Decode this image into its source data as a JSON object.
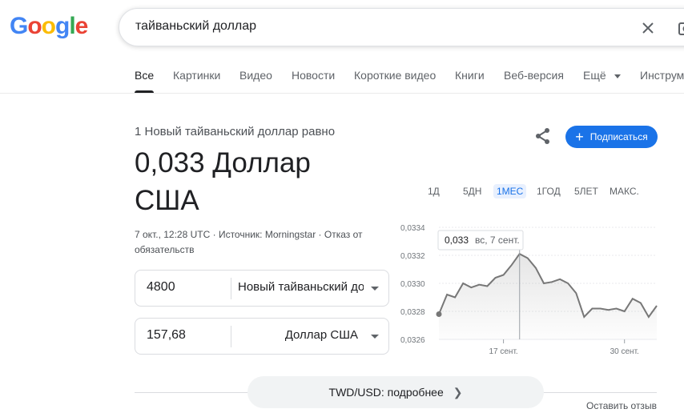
{
  "logo": {
    "letters": [
      "G",
      "o",
      "o",
      "g",
      "l",
      "e"
    ],
    "colors": [
      "#4285f4",
      "#ea4335",
      "#fbbc05",
      "#4285f4",
      "#34a853",
      "#ea4335"
    ]
  },
  "search": {
    "query": "тайваньский доллар"
  },
  "tabs": [
    "Все",
    "Картинки",
    "Видео",
    "Новости",
    "Короткие видео",
    "Книги",
    "Веб-версия",
    "Ещё",
    "Инструм"
  ],
  "converter": {
    "equals_text": "1 Новый тайваньский доллар равно",
    "result_text": "0,033 Доллар США",
    "timestamp": "7 окт., 12:28 UTC",
    "source": "Источник: Morningstar",
    "disclaimer": "Отказ от обязательств",
    "from_amount": "4800",
    "from_currency": "Новый тайваньский до",
    "to_amount": "157,68",
    "to_currency": "Доллар США"
  },
  "actions": {
    "subscribe": "Подписаться"
  },
  "ranges": [
    "1Д",
    "5ДН",
    "1МЕС",
    "1ГОД",
    "5ЛЕТ",
    "МАКС."
  ],
  "active_range": "1МЕС",
  "more": "TWD/USD: подробнее",
  "feedback": "Оставить отзыв",
  "colors": {
    "accent": "#1a73e8",
    "line": "#777777"
  },
  "chart_data": {
    "type": "line",
    "y_ticks": [
      "0,0334",
      "0,0332",
      "0,0330",
      "0,0328",
      "0,0326"
    ],
    "ylim": [
      0.0326,
      0.0334
    ],
    "x_ticks": [
      "17 сент.",
      "30 сент."
    ],
    "tooltip": {
      "value": "0,033",
      "label": "вс, 7 сент."
    },
    "values": [
      0.03278,
      0.03292,
      0.0329,
      0.033,
      0.03297,
      0.03299,
      0.03298,
      0.03304,
      0.03306,
      0.03313,
      0.03321,
      0.03318,
      0.03311,
      0.033,
      0.03301,
      0.03303,
      0.033,
      0.03293,
      0.03276,
      0.03282,
      0.03282,
      0.03281,
      0.03282,
      0.0328,
      0.03289,
      0.03286,
      0.03276,
      0.03284
    ]
  }
}
